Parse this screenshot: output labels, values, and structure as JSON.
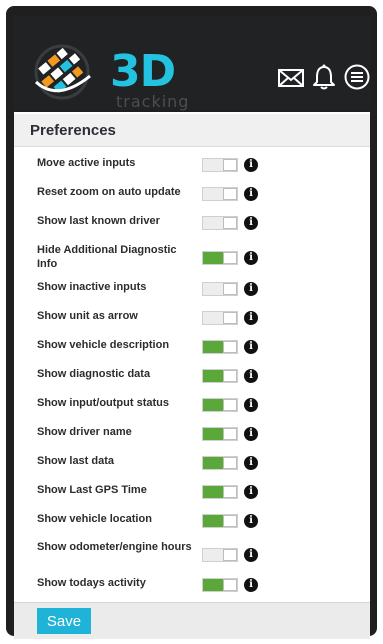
{
  "header": {
    "logo_main": "3D",
    "logo_sub": "tracking",
    "icons": [
      "mail-icon",
      "bell-icon",
      "menu-icon"
    ],
    "colors": {
      "brand": "#23c2e0",
      "header_bg": "#212223",
      "toggle_on": "#5aa83a"
    }
  },
  "panel": {
    "title": "Preferences"
  },
  "preferences": [
    {
      "label": "Move active inputs",
      "enabled": false
    },
    {
      "label": "Reset zoom on auto update",
      "enabled": false
    },
    {
      "label": "Show last known driver",
      "enabled": false
    },
    {
      "label": "Hide Additional Diagnostic Info",
      "enabled": true
    },
    {
      "label": "Show inactive inputs",
      "enabled": false
    },
    {
      "label": "Show unit as arrow",
      "enabled": false
    },
    {
      "label": "Show vehicle description",
      "enabled": true
    },
    {
      "label": "Show diagnostic data",
      "enabled": true
    },
    {
      "label": "Show input/output status",
      "enabled": true
    },
    {
      "label": "Show driver name",
      "enabled": true
    },
    {
      "label": "Show last data",
      "enabled": true
    },
    {
      "label": "Show Last GPS Time",
      "enabled": true
    },
    {
      "label": "Show vehicle location",
      "enabled": true
    },
    {
      "label": "Show odometer/engine hours",
      "enabled": false
    },
    {
      "label": "Show todays activity",
      "enabled": true
    }
  ],
  "info_glyph": "i",
  "footer": {
    "save_label": "Save"
  }
}
